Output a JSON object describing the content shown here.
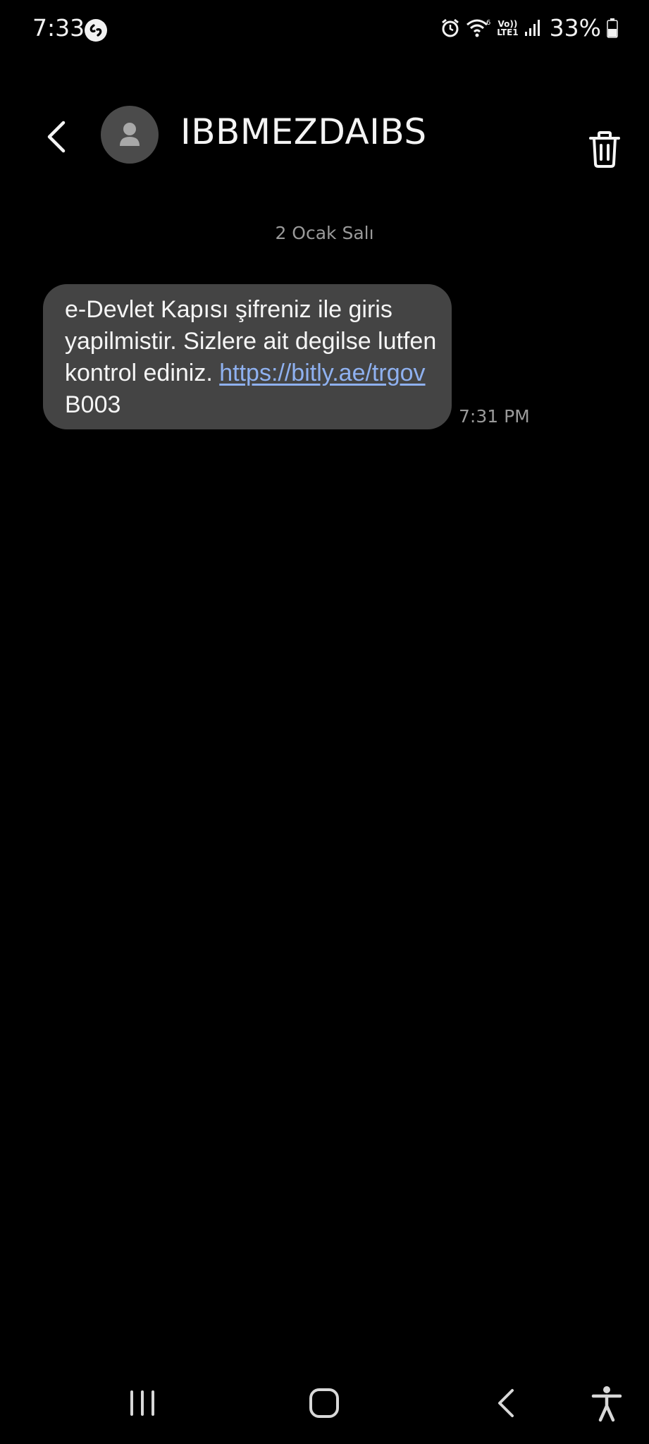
{
  "status_bar": {
    "time": "7:33",
    "battery": "33%",
    "network_label": "LTE1",
    "volte_label": "Vo))",
    "wifi_badge": "6"
  },
  "header": {
    "contact_name": "IBBMEZDAIBS"
  },
  "conversation": {
    "date_separator": "2 Ocak Salı",
    "message": {
      "text_before_link": "e-Devlet Kapısı şifreniz ile giris yapilmistir. Sizlere ait degilse lutfen kontrol ediniz. ",
      "link": "https://bitly.ae/trgov",
      "text_after_link": " B003",
      "time": "7:31 PM"
    }
  },
  "colors": {
    "background": "#000000",
    "bubble": "#444444",
    "link": "#8fb1f0",
    "muted_text": "#9a9a9a"
  },
  "icons": {
    "back": "back-arrow-icon",
    "avatar": "person-icon",
    "delete": "trash-icon",
    "nav_recents": "recents-icon",
    "nav_home": "home-icon",
    "nav_back": "back-icon",
    "accessibility": "accessibility-icon"
  }
}
